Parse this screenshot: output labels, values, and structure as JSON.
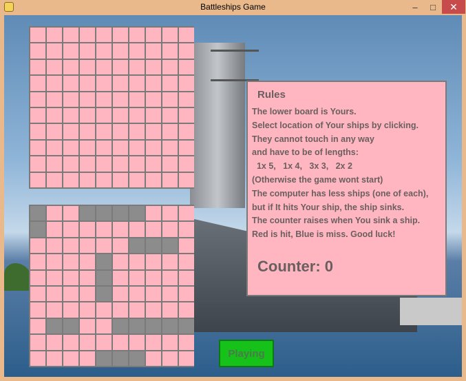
{
  "window": {
    "title": "Battleships Game",
    "controls": {
      "minimize": "–",
      "maximize": "□",
      "close": "✕"
    }
  },
  "boards": {
    "top_label": "",
    "bottom_label": "",
    "top_grid": [
      [
        0,
        0,
        0,
        0,
        0,
        0,
        0,
        0,
        0,
        0
      ],
      [
        0,
        0,
        0,
        0,
        0,
        0,
        0,
        0,
        0,
        0
      ],
      [
        0,
        0,
        0,
        0,
        0,
        0,
        0,
        0,
        0,
        0
      ],
      [
        0,
        0,
        0,
        0,
        0,
        0,
        0,
        0,
        0,
        0
      ],
      [
        0,
        0,
        0,
        0,
        0,
        0,
        0,
        0,
        0,
        0
      ],
      [
        0,
        0,
        0,
        0,
        0,
        0,
        0,
        0,
        0,
        0
      ],
      [
        0,
        0,
        0,
        0,
        0,
        0,
        0,
        0,
        0,
        0
      ],
      [
        0,
        0,
        0,
        0,
        0,
        0,
        0,
        0,
        0,
        0
      ],
      [
        0,
        0,
        0,
        0,
        0,
        0,
        0,
        0,
        0,
        0
      ],
      [
        0,
        0,
        0,
        0,
        0,
        0,
        0,
        0,
        0,
        0
      ]
    ],
    "bottom_grid": [
      [
        1,
        0,
        0,
        1,
        1,
        1,
        1,
        0,
        0,
        0
      ],
      [
        1,
        0,
        0,
        0,
        0,
        0,
        0,
        0,
        0,
        0
      ],
      [
        0,
        0,
        0,
        0,
        0,
        0,
        1,
        1,
        1,
        0
      ],
      [
        0,
        0,
        0,
        0,
        1,
        0,
        0,
        0,
        0,
        0
      ],
      [
        0,
        0,
        0,
        0,
        1,
        0,
        0,
        0,
        0,
        0
      ],
      [
        0,
        0,
        0,
        0,
        1,
        0,
        0,
        0,
        0,
        0
      ],
      [
        0,
        0,
        0,
        0,
        0,
        0,
        0,
        0,
        0,
        0
      ],
      [
        0,
        1,
        1,
        0,
        0,
        1,
        1,
        1,
        1,
        1
      ],
      [
        0,
        0,
        0,
        0,
        0,
        0,
        0,
        0,
        0,
        0
      ],
      [
        0,
        0,
        0,
        0,
        1,
        1,
        1,
        0,
        0,
        0
      ]
    ]
  },
  "rules": {
    "title": "Rules",
    "lines": [
      "The lower board is Yours.",
      "Select location of Your ships by clicking.",
      "They cannot touch in any way",
      "and have to be of lengths:",
      "  1x 5,   1x 4,   3x 3,   2x 2",
      "(Otherwise the game wont start)",
      "The computer has less ships (one of each),",
      "but if It hits Your ship, the ship sinks.",
      "The counter raises when You sink a ship.",
      "Red is hit, Blue is miss. Good luck!"
    ],
    "counter_label": "Counter: 0"
  },
  "status_button": {
    "label": "Playing",
    "color": "#16c21a"
  }
}
